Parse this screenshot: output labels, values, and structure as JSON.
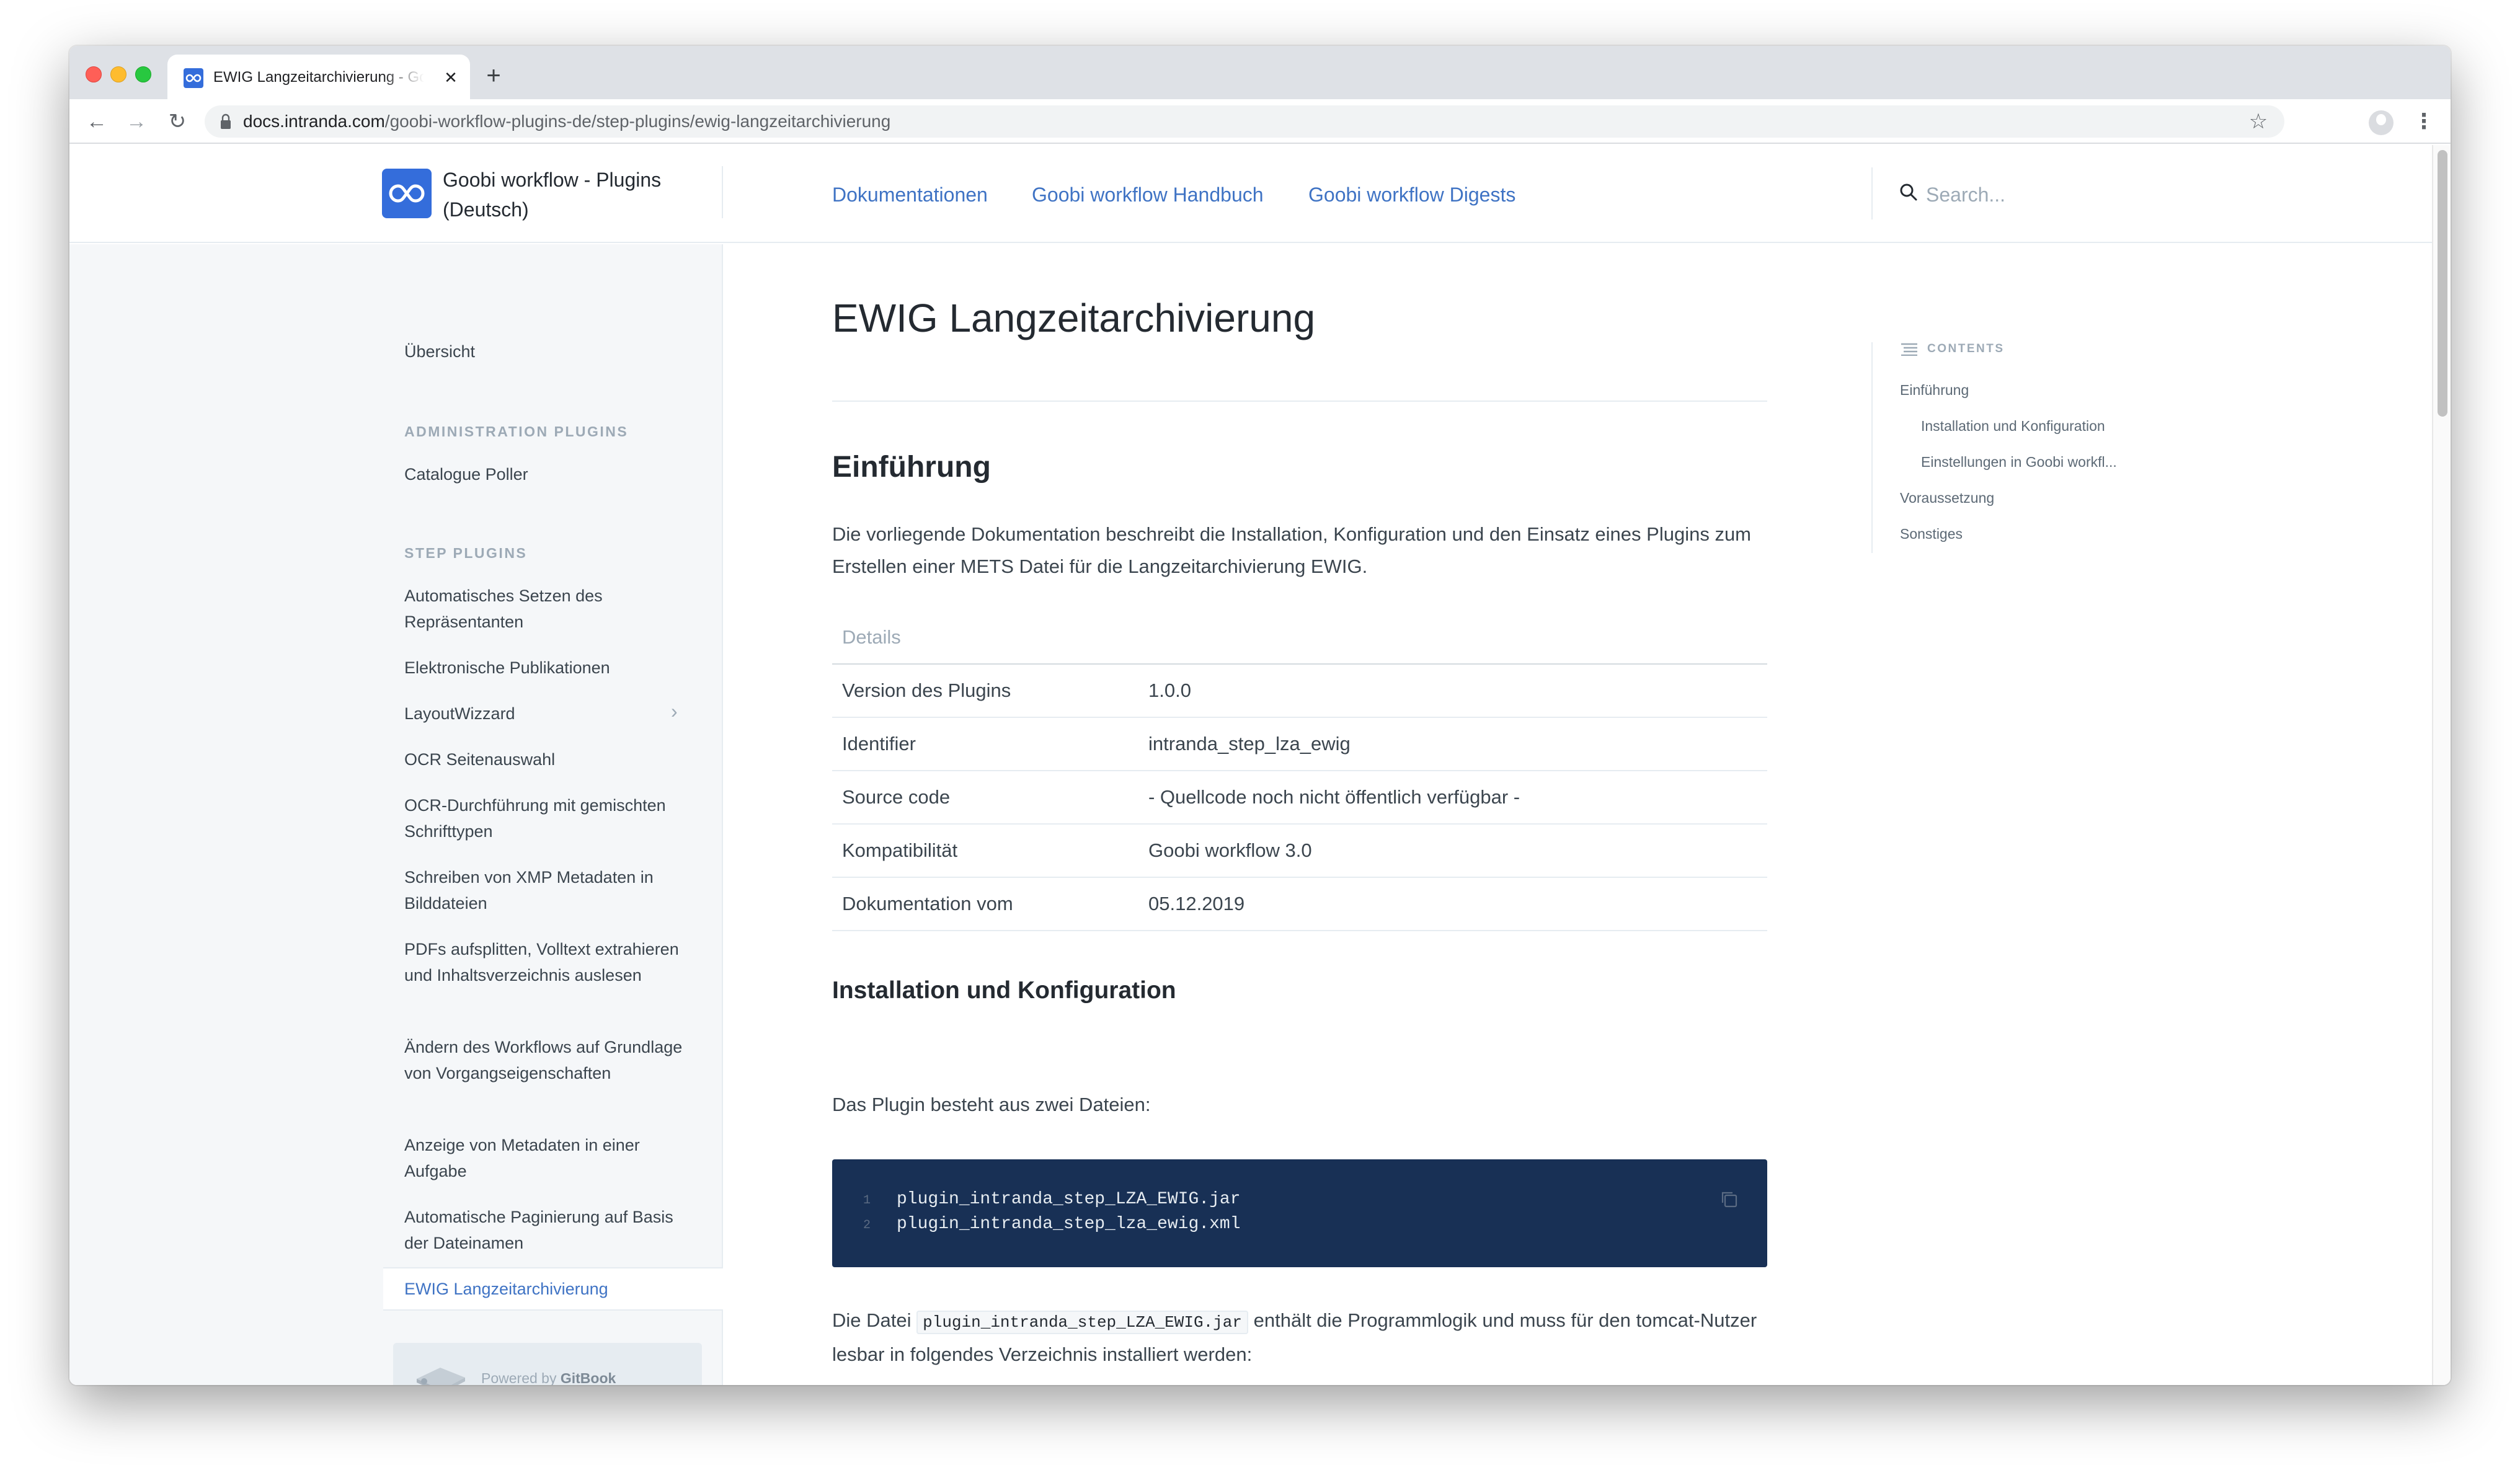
{
  "browser": {
    "tab_title": "EWIG Langzeitarchivierung - Goobi workflow - Plugins (Deutsch)",
    "tab_close": "✕",
    "new_tab": "+",
    "url_host": "docs.intranda.com",
    "url_path": "/goobi-workflow-plugins-de/step-plugins/ewig-langzeitarchivierung"
  },
  "header": {
    "site_title": "Goobi workflow - Plugins (Deutsch)",
    "nav": [
      "Dokumentationen",
      "Goobi workflow Handbuch",
      "Goobi workflow Digests"
    ],
    "search_placeholder": "Search..."
  },
  "sidebar": {
    "overview": "Übersicht",
    "admin_heading": "ADMINISTRATION PLUGINS",
    "admin_items": [
      "Catalogue Poller"
    ],
    "step_heading": "STEP PLUGINS",
    "step_items": [
      "Automatisches Setzen des Repräsentanten",
      "Elektronische Publikationen",
      "LayoutWizzard",
      "OCR Seitenauswahl",
      "OCR-Durchführung mit gemischten Schrifttypen",
      "Schreiben von XMP Metadaten in Bilddateien",
      "PDFs aufsplitten, Volltext extrahieren und Inhaltsverzeichnis auslesen",
      "Ändern des Workflows auf Grundlage von Vorgangseigenschaften",
      "Anzeige von Metadaten in einer Aufgabe",
      "Automatische Paginierung auf Basis der Dateinamen",
      "EWIG Langzeitarchivierung"
    ],
    "active_item": "EWIG Langzeitarchivierung",
    "powered_prefix": "Powered by ",
    "powered_brand": "GitBook"
  },
  "main": {
    "title": "EWIG Langzeitarchivierung",
    "intro_heading": "Einführung",
    "intro_text": "Die vorliegende Dokumentation beschreibt die Installation, Konfiguration und den Einsatz eines Plugins zum Erstellen einer METS Datei für die Langzeitarchivierung EWIG.",
    "details_table": {
      "header": "Details",
      "rows": [
        {
          "key": "Version des Plugins",
          "value": "1.0.0"
        },
        {
          "key": "Identifier",
          "value": "intranda_step_lza_ewig"
        },
        {
          "key": "Source code",
          "value": "- Quellcode noch nicht öffentlich verfügbar -"
        },
        {
          "key": "Kompatibilität",
          "value": "Goobi workflow 3.0"
        },
        {
          "key": "Dokumentation vom",
          "value": "05.12.2019"
        }
      ]
    },
    "install_heading": "Installation und Konfiguration",
    "install_text": "Das Plugin besteht aus zwei Dateien:",
    "code_block_1": {
      "lines": [
        {
          "num": "1",
          "text": "plugin_intranda_step_LZA_EWIG.jar"
        },
        {
          "num": "2",
          "text": "plugin_intranda_step_lza_ewig.xml"
        }
      ]
    },
    "file_text_before": "Die Datei ",
    "file_code": "plugin_intranda_step_LZA_EWIG.jar",
    "file_text_after": " enthält die Programmlogik und muss für den tomcat-Nutzer lesbar in folgendes Verzeichnis installiert werden:"
  },
  "toc": {
    "heading": "CONTENTS",
    "items": [
      {
        "label": "Einführung",
        "level": 1
      },
      {
        "label": "Installation und Konfiguration",
        "level": 2
      },
      {
        "label": "Einstellungen in Goobi workfl...",
        "level": 2
      },
      {
        "label": "Voraussetzung",
        "level": 1
      },
      {
        "label": "Sonstiges",
        "level": 1
      }
    ]
  },
  "colors": {
    "accent": "#3f73c4",
    "logo": "#346ddb",
    "code_bg": "#183055",
    "sidebar_bg": "#f5f7f9"
  },
  "icons": [
    "logo-infinity-icon",
    "search-icon",
    "chevron-right-icon",
    "copy-icon",
    "toc-list-icon",
    "lock-icon",
    "star-icon",
    "gitbook-icon"
  ]
}
